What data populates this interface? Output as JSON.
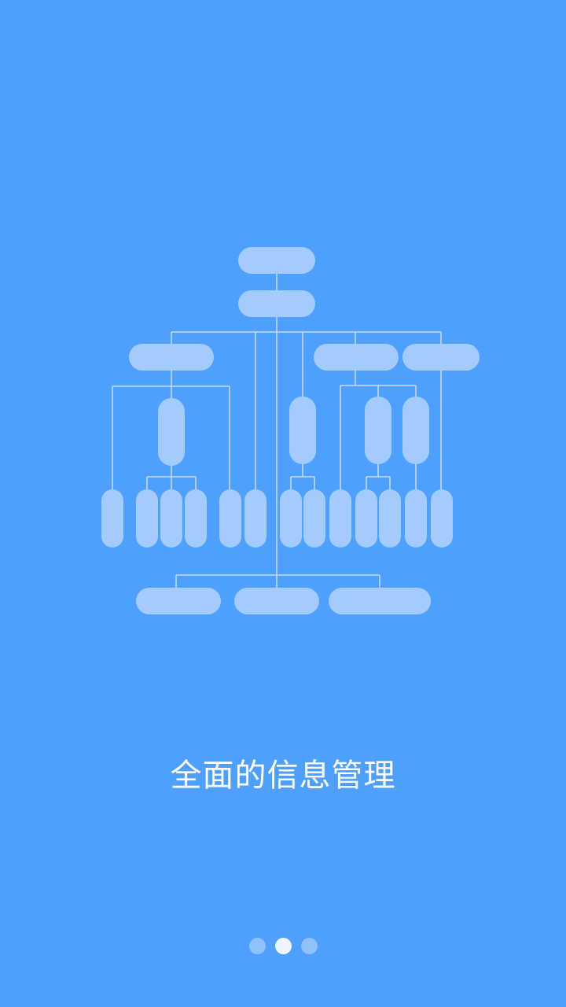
{
  "onboarding": {
    "caption": "全面的信息管理",
    "illustration_icon": "org-chart-illustration",
    "page_indicator": {
      "total": 3,
      "active_index": 1
    }
  },
  "colors": {
    "background": "#4f9ffc",
    "node_fill": "#a4cbfd",
    "connector": "#c4dcfd",
    "caption_text": "#ffffff"
  }
}
